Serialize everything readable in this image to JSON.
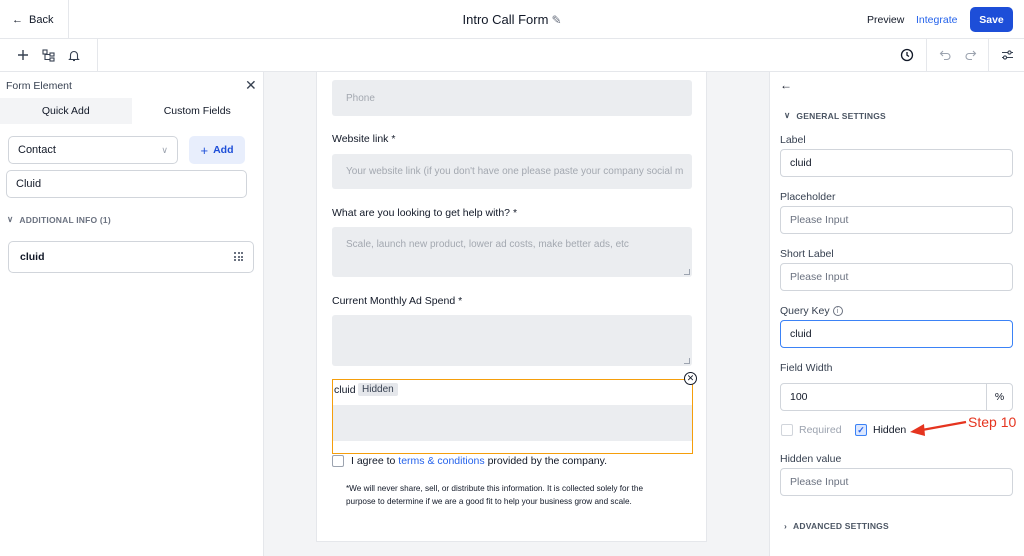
{
  "header": {
    "back_label": "Back",
    "title": "Intro Call Form",
    "preview_label": "Preview",
    "integrate_label": "Integrate",
    "save_label": "Save",
    "accent_color": "#1d4ed8"
  },
  "toolbar": {
    "left_icons": [
      "plus-icon",
      "element-tree-icon",
      "bell-icon"
    ],
    "right_icons": [
      "history-icon",
      "undo-icon",
      "redo-icon",
      "settings-sliders-icon"
    ]
  },
  "left_panel": {
    "title": "Form Element",
    "tabs": [
      {
        "label": "Quick Add",
        "active": false
      },
      {
        "label": "Custom Fields",
        "active": true
      }
    ],
    "object_select": "Contact",
    "add_label": "Add",
    "search_value": "Cluid",
    "section_label": "ADDITIONAL INFO (1)",
    "fields": [
      {
        "label": "cluid"
      }
    ]
  },
  "canvas": {
    "phone_placeholder": "Phone",
    "website_label": "Website link *",
    "website_placeholder": "Your website link (if you don't have one please paste your company social m",
    "help_label": "What are you looking to get help with? *",
    "help_placeholder": "Scale, launch new product, lower ad costs, make better ads, etc",
    "adspend_label": "Current Monthly Ad Spend *",
    "hidden_field_label": "cluid",
    "hidden_badge": "Hidden",
    "agree_prefix": "I agree to ",
    "agree_link": "terms & conditions",
    "agree_suffix": " provided by the company.",
    "disclaimer": "*We will never share, sell, or distribute this information. It is collected solely for the purpose to determine if we are a good fit to help your business grow and scale."
  },
  "right_panel": {
    "section_general": "GENERAL SETTINGS",
    "label_label": "Label",
    "label_value": "cluid",
    "placeholder_label": "Placeholder",
    "placeholder_value": "Please Input",
    "short_label_label": "Short Label",
    "short_label_value": "Please Input",
    "query_key_label": "Query Key",
    "query_key_value": "cluid",
    "field_width_label": "Field Width",
    "field_width_value": "100",
    "field_width_unit": "%",
    "required_label": "Required",
    "required_checked": false,
    "hidden_label": "Hidden",
    "hidden_checked": true,
    "hidden_value_label": "Hidden value",
    "hidden_value_value": "Please Input",
    "section_advanced": "ADVANCED SETTINGS"
  },
  "annotation": {
    "text": "Step 10",
    "color": "#e5341f"
  }
}
